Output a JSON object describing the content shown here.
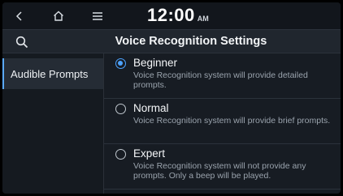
{
  "status_bar": {
    "time": "12:00",
    "ampm": "AM",
    "nav": [
      {
        "name": "back-icon",
        "glyph": "<"
      },
      {
        "name": "home-icon",
        "glyph": "⌂"
      },
      {
        "name": "menu-icon",
        "glyph": "≡"
      }
    ]
  },
  "header": {
    "title": "Voice Recognition Settings",
    "search_icon": "search-icon"
  },
  "sidebar": {
    "items": [
      {
        "label": "Audible Prompts",
        "selected": true
      }
    ]
  },
  "options": [
    {
      "title": "Beginner",
      "description": "Voice Recognition system will provide detailed prompts.",
      "selected": true
    },
    {
      "title": "Normal",
      "description": "Voice Recognition system will provide brief prompts.",
      "selected": false
    },
    {
      "title": "Expert",
      "description": "Voice Recognition system will not provide any prompts. Only a beep will be played.",
      "selected": false
    }
  ],
  "colors": {
    "accent": "#4da3ff",
    "background": "#171c23",
    "selected_item": "#252c35"
  }
}
